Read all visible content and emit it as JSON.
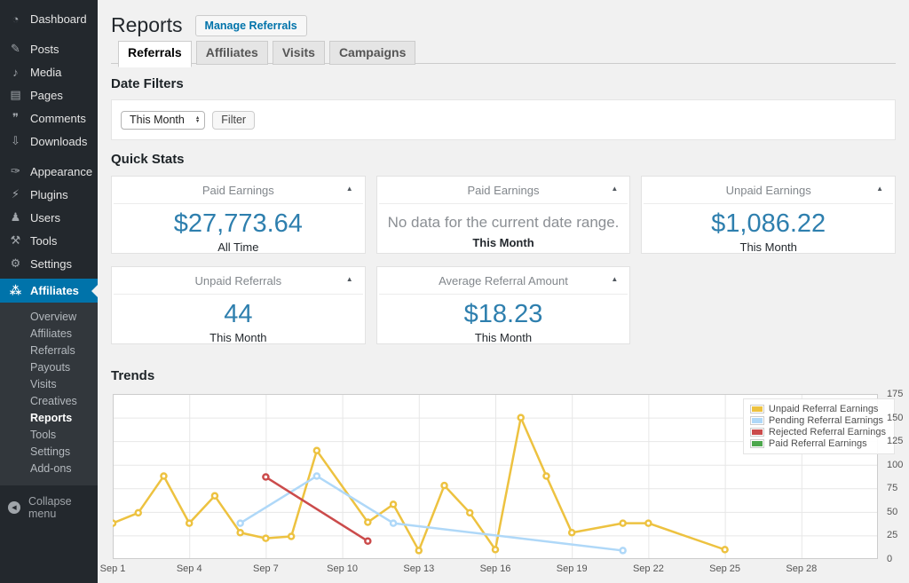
{
  "page": {
    "title": "Reports",
    "action_button": "Manage Referrals"
  },
  "sidebar": {
    "items": [
      "Dashboard",
      "Posts",
      "Media",
      "Pages",
      "Comments",
      "Downloads",
      "Appearance",
      "Plugins",
      "Users",
      "Tools",
      "Settings",
      "Affiliates"
    ],
    "submenu": [
      "Overview",
      "Affiliates",
      "Referrals",
      "Payouts",
      "Visits",
      "Creatives",
      "Reports",
      "Tools",
      "Settings",
      "Add-ons"
    ],
    "current_submenu_item": "Reports",
    "collapse_label": "Collapse menu",
    "active_color": "#0073aa",
    "background_color": "#23282d"
  },
  "tabs": [
    {
      "label": "Referrals",
      "active": true
    },
    {
      "label": "Affiliates",
      "active": false
    },
    {
      "label": "Visits",
      "active": false
    },
    {
      "label": "Campaigns",
      "active": false
    }
  ],
  "date_filters": {
    "heading": "Date Filters",
    "selected_range": "This Month",
    "filter_button": "Filter"
  },
  "quick_stats": {
    "heading": "Quick Stats",
    "cards": [
      {
        "title": "Paid Earnings",
        "value": "$27,773.64",
        "period": "All Time"
      },
      {
        "title": "Paid Earnings",
        "message": "No data for the current date range.",
        "period": "This Month"
      },
      {
        "title": "Unpaid Earnings",
        "value": "$1,086.22",
        "period": "This Month"
      },
      {
        "title": "Unpaid Referrals",
        "value": "44",
        "period": "This Month"
      },
      {
        "title": "Average Referral Amount",
        "value": "$18.23",
        "period": "This Month"
      }
    ]
  },
  "trends": {
    "heading": "Trends"
  },
  "chart_data": {
    "type": "line",
    "x_unit": "day of September",
    "x_tick_days": [
      1,
      4,
      7,
      10,
      13,
      16,
      19,
      22,
      25,
      28
    ],
    "x_tick_labels": [
      "Sep 1",
      "Sep 4",
      "Sep 7",
      "Sep 10",
      "Sep 13",
      "Sep 16",
      "Sep 19",
      "Sep 22",
      "Sep 25",
      "Sep 28"
    ],
    "x_range_days": [
      1,
      31
    ],
    "ylim": [
      0,
      175
    ],
    "y_ticks": [
      0,
      25,
      50,
      75,
      100,
      125,
      150,
      175
    ],
    "grid": true,
    "legend_position": "top-right",
    "series": [
      {
        "name": "Unpaid Referral Earnings",
        "color": "#EDC240",
        "points": [
          [
            1,
            38
          ],
          [
            2,
            49
          ],
          [
            3,
            88
          ],
          [
            4,
            38
          ],
          [
            5,
            67
          ],
          [
            6,
            28
          ],
          [
            7,
            22
          ],
          [
            8,
            24
          ],
          [
            9,
            115
          ],
          [
            11,
            39
          ],
          [
            12,
            58
          ],
          [
            13,
            9
          ],
          [
            14,
            78
          ],
          [
            15,
            49
          ],
          [
            16,
            10
          ],
          [
            17,
            150
          ],
          [
            18,
            88
          ],
          [
            19,
            28
          ],
          [
            21,
            38
          ],
          [
            22,
            38
          ],
          [
            25,
            10
          ]
        ]
      },
      {
        "name": "Pending Referral Earnings",
        "color": "#AFD8F8",
        "points": [
          [
            6,
            38
          ],
          [
            9,
            88
          ],
          [
            12,
            38
          ],
          [
            21,
            9
          ]
        ]
      },
      {
        "name": "Rejected Referral Earnings",
        "color": "#CB4B4B",
        "points": [
          [
            7,
            87
          ],
          [
            11,
            19
          ]
        ]
      },
      {
        "name": "Paid Referral Earnings",
        "color": "#4DA74D",
        "points": []
      }
    ]
  },
  "icons": {
    "dashboard-icon": "◔",
    "posts-icon": "✎",
    "media-icon": "♪",
    "pages-icon": "▤",
    "comments-icon": "❞",
    "downloads-icon": "⇩",
    "appearance-icon": "✑",
    "plugins-icon": "⚡",
    "users-icon": "♟",
    "tools-icon": "⚒",
    "settings-icon": "⚙",
    "affiliates-icon": "⁂",
    "collapse-icon": "◀",
    "card-toggle-icon": "▲",
    "select-up-icon": "▲",
    "select-down-icon": "▼"
  }
}
